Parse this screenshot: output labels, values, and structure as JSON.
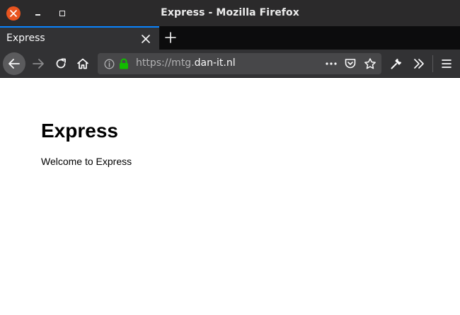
{
  "window": {
    "title": "Express - Mozilla Firefox"
  },
  "tabs": [
    {
      "label": "Express",
      "active": true
    }
  ],
  "urlbar": {
    "scheme_prefix": "https://mtg.",
    "domain": "dan-it.nl",
    "path": ""
  },
  "page": {
    "heading": "Express",
    "body": "Welcome to Express"
  },
  "colors": {
    "close_button": "#e9541f",
    "tab_accent": "#0a84ff",
    "lock_green": "#12bc00",
    "toolbar": "#323234",
    "urlbar": "#474749"
  },
  "icons": {
    "window_close": "close-icon",
    "window_minimize": "minimize-icon",
    "window_maximize": "maximize-icon",
    "tab_close": "close-icon",
    "new_tab": "plus-icon",
    "back": "arrow-left-icon",
    "forward": "arrow-right-icon",
    "reload": "reload-icon",
    "home": "home-icon",
    "site_info": "info-icon",
    "secure": "lock-icon",
    "page_actions": "more-icon",
    "pocket": "pocket-icon",
    "bookmark": "star-icon",
    "developer": "wrench-icon",
    "overflow": "chevrons-right-icon",
    "menu": "hamburger-icon"
  }
}
